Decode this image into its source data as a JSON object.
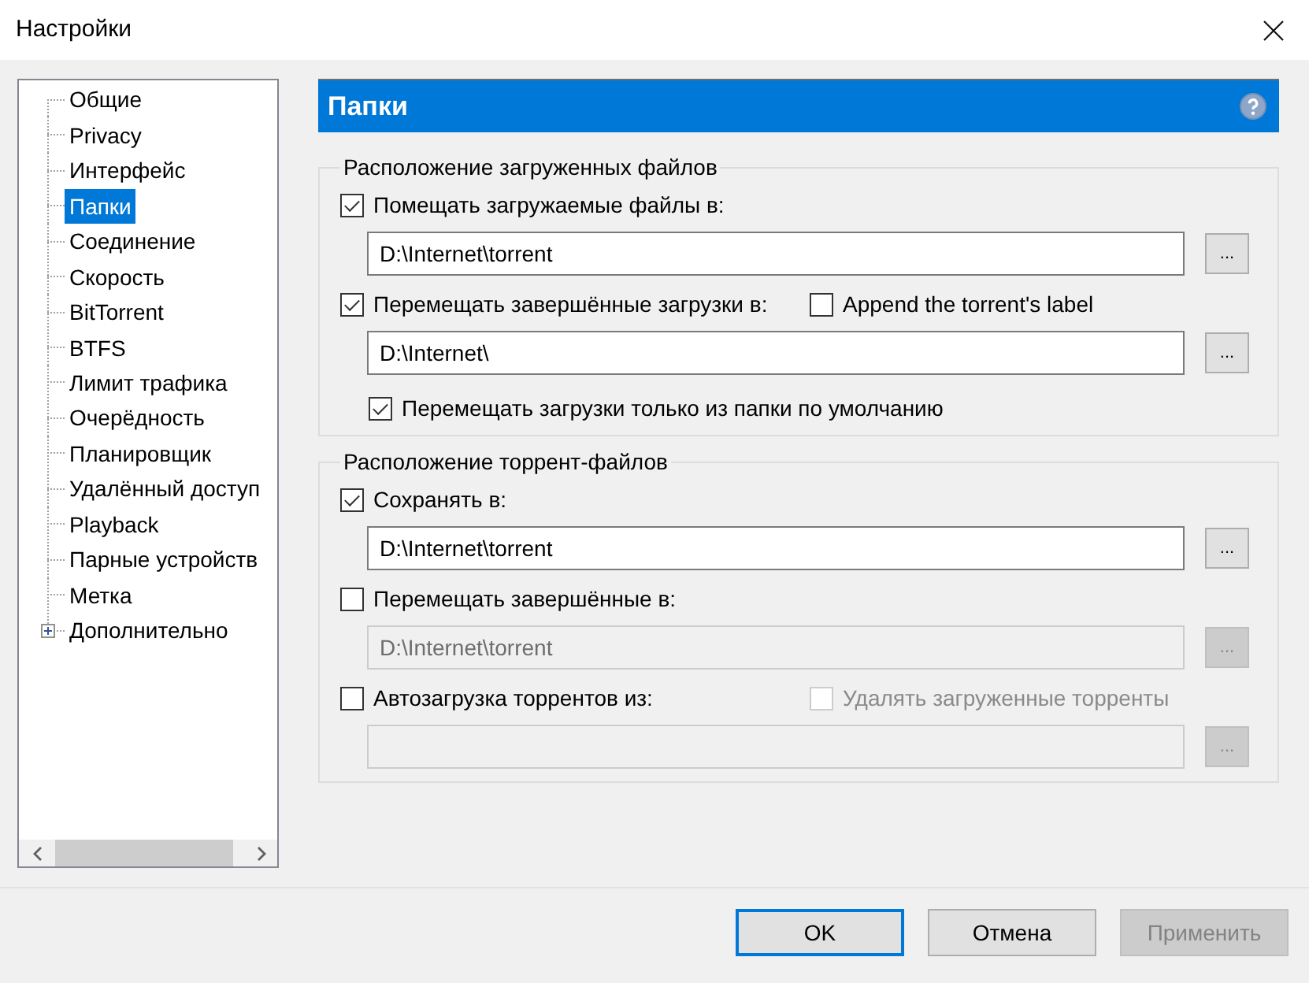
{
  "window": {
    "title": "Настройки"
  },
  "sidebar": {
    "items": [
      {
        "label": "Общие",
        "kind": "leaf",
        "selected": false
      },
      {
        "label": "Privacy",
        "kind": "leaf",
        "selected": false
      },
      {
        "label": "Интерфейс",
        "kind": "leaf",
        "selected": false
      },
      {
        "label": "Папки",
        "kind": "leaf",
        "selected": true
      },
      {
        "label": "Соединение",
        "kind": "leaf",
        "selected": false
      },
      {
        "label": "Скорость",
        "kind": "leaf",
        "selected": false
      },
      {
        "label": "BitTorrent",
        "kind": "leaf",
        "selected": false
      },
      {
        "label": "BTFS",
        "kind": "leaf",
        "selected": false
      },
      {
        "label": "Лимит трафика",
        "kind": "leaf",
        "selected": false
      },
      {
        "label": "Очерёдность",
        "kind": "leaf",
        "selected": false
      },
      {
        "label": "Планировщик",
        "kind": "leaf",
        "selected": false
      },
      {
        "label": "Удалённый доступ",
        "kind": "leaf",
        "selected": false
      },
      {
        "label": "Playback",
        "kind": "leaf",
        "selected": false
      },
      {
        "label": "Парные устройств",
        "kind": "leaf",
        "selected": false
      },
      {
        "label": "Метка",
        "kind": "leaf",
        "selected": false
      },
      {
        "label": "Дополнительно",
        "kind": "group",
        "selected": false,
        "expanded": false
      }
    ]
  },
  "panel": {
    "title": "Папки",
    "groups": [
      {
        "title": "Расположение загруженных файлов",
        "rows": [
          {
            "kind": "checkbox",
            "label": "Помещать загружаемые файлы в:",
            "checked": true,
            "disabled": false
          },
          {
            "kind": "path",
            "value": "D:\\Internet\\torrent",
            "disabled": false,
            "button_label": "..."
          },
          {
            "kind": "checkbox",
            "label": "Перемещать завершённые загрузки в:",
            "checked": true,
            "disabled": false,
            "extra": {
              "label": "Append the torrent's label",
              "checked": false,
              "disabled": false
            }
          },
          {
            "kind": "path",
            "value": "D:\\Internet\\",
            "disabled": false,
            "button_label": "..."
          },
          {
            "kind": "subcheckbox",
            "label": "Перемещать загрузки только из папки по умолчанию",
            "checked": true,
            "disabled": false
          }
        ]
      },
      {
        "title": "Расположение торрент-файлов",
        "rows": [
          {
            "kind": "checkbox",
            "label": "Сохранять в:",
            "checked": true,
            "disabled": false
          },
          {
            "kind": "path",
            "value": "D:\\Internet\\torrent",
            "disabled": false,
            "button_label": "..."
          },
          {
            "kind": "checkbox",
            "label": "Перемещать завершённые в:",
            "checked": false,
            "disabled": false
          },
          {
            "kind": "path",
            "value": "D:\\Internet\\torrent",
            "disabled": true,
            "button_label": "..."
          },
          {
            "kind": "checkbox",
            "label": "Автозагрузка торрентов из:",
            "checked": false,
            "disabled": false,
            "extra": {
              "label": "Удалять загруженные торренты",
              "checked": false,
              "disabled": true
            }
          },
          {
            "kind": "path",
            "disabled": true,
            "button_label": "..."
          }
        ]
      }
    ]
  },
  "buttons": [
    {
      "label": "OK",
      "default": true,
      "disabled": false
    },
    {
      "label": "Отмена",
      "default": false,
      "disabled": false
    },
    {
      "label": "Применить",
      "default": false,
      "disabled": true
    }
  ]
}
